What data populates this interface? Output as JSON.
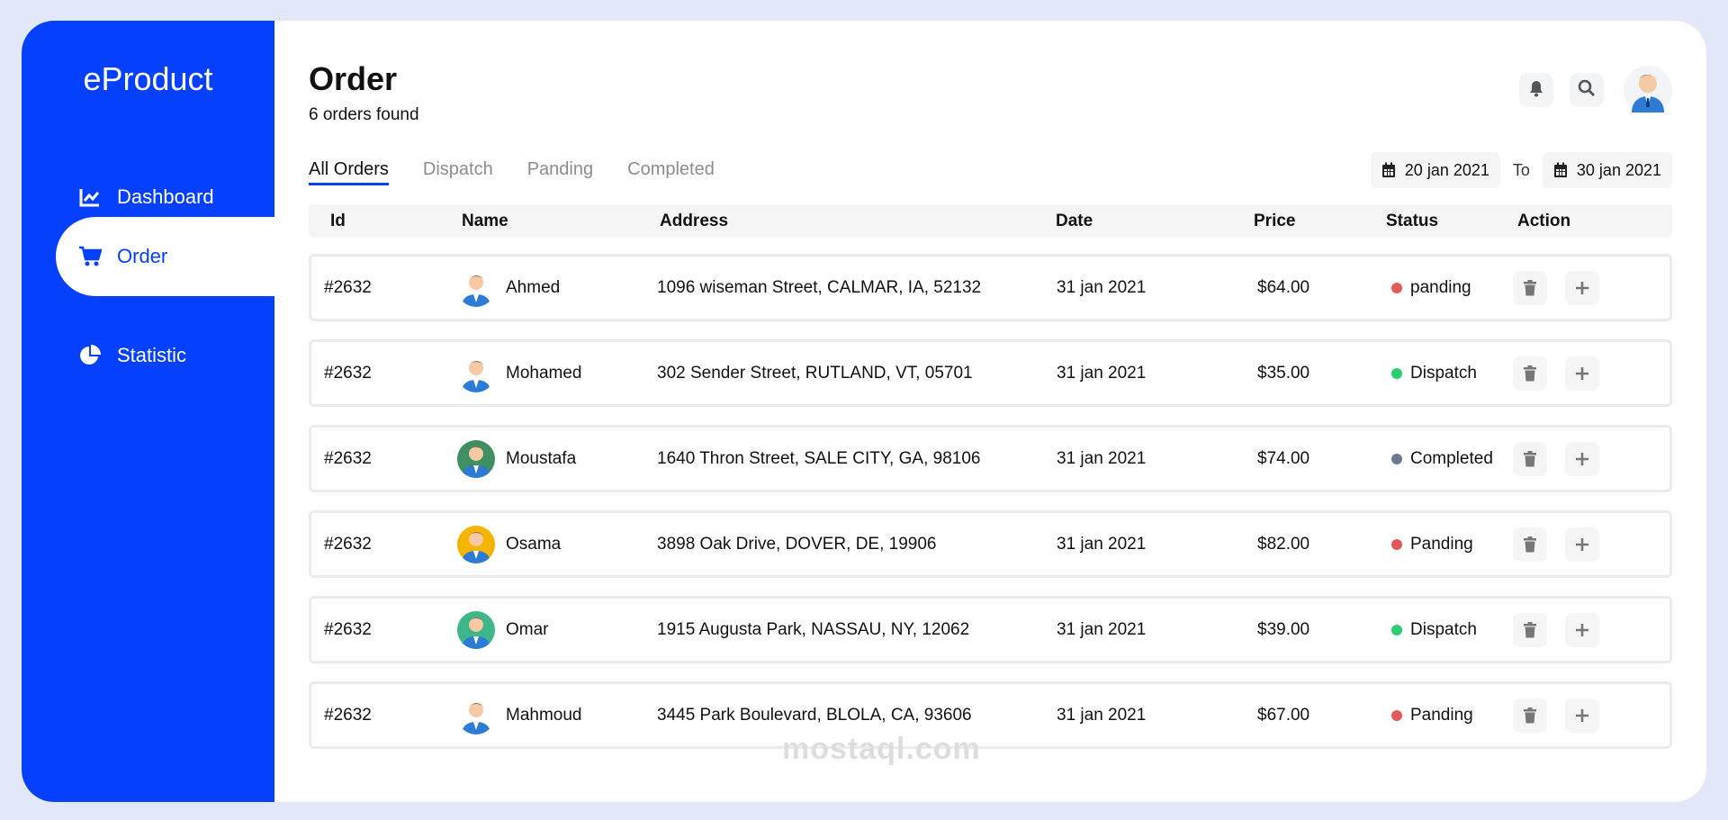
{
  "app": {
    "name": "eProduct"
  },
  "sidebar": {
    "items": [
      {
        "label": "Dashboard",
        "icon": "chart-line-icon",
        "active": false
      },
      {
        "label": "Order",
        "icon": "shopping-cart-icon",
        "active": true
      },
      {
        "label": "Statistic",
        "icon": "pie-chart-icon",
        "active": false
      }
    ]
  },
  "header": {
    "title": "Order",
    "subtitle": "6 orders found"
  },
  "tabs": [
    {
      "label": "All Orders",
      "active": true
    },
    {
      "label": "Dispatch",
      "active": false
    },
    {
      "label": "Panding",
      "active": false
    },
    {
      "label": "Completed",
      "active": false
    }
  ],
  "date_range": {
    "from": "20 jan 2021",
    "to_label": "To",
    "to": "30 jan 2021"
  },
  "table": {
    "columns": [
      "Id",
      "Name",
      "Address",
      "Date",
      "Price",
      "Status",
      "Action"
    ],
    "rows": [
      {
        "id": "#2632",
        "name": "Ahmed",
        "address": "1096 wiseman Street, CALMAR, IA, 52132",
        "date": "31 jan 2021",
        "price": "$64.00",
        "status": "panding",
        "status_color": "#e05a5a",
        "avatar_color": "#ffffff"
      },
      {
        "id": "#2632",
        "name": "Mohamed",
        "address": "302 Sender Street, RUTLAND, VT, 05701",
        "date": "31 jan 2021",
        "price": "$35.00",
        "status": "Dispatch",
        "status_color": "#2ecc71",
        "avatar_color": "#ffffff"
      },
      {
        "id": "#2632",
        "name": "Moustafa",
        "address": "1640 Thron Street, SALE CITY, GA, 98106",
        "date": "31 jan 2021",
        "price": "$74.00",
        "status": "Completed",
        "status_color": "#6b7a8f",
        "avatar_color": "#3f8f63"
      },
      {
        "id": "#2632",
        "name": "Osama",
        "address": "3898 Oak Drive, DOVER, DE, 19906",
        "date": "31 jan 2021",
        "price": "$82.00",
        "status": "Panding",
        "status_color": "#e05a5a",
        "avatar_color": "#f5b400"
      },
      {
        "id": "#2632",
        "name": "Omar",
        "address": "1915 Augusta Park, NASSAU, NY, 12062",
        "date": "31 jan 2021",
        "price": "$39.00",
        "status": "Dispatch",
        "status_color": "#2ecc71",
        "avatar_color": "#3fb58a"
      },
      {
        "id": "#2632",
        "name": "Mahmoud",
        "address": "3445 Park Boulevard, BLOLA, CA, 93606",
        "date": "31 jan 2021",
        "price": "$67.00",
        "status": "Panding",
        "status_color": "#e05a5a",
        "avatar_color": "#ffffff"
      }
    ]
  },
  "icons": {
    "notification": "bell-icon",
    "search": "search-icon",
    "delete": "trash-icon",
    "add": "plus-icon",
    "calendar": "calendar-icon"
  },
  "watermark": "mostaql.com",
  "colors": {
    "brand": "#0540fc",
    "background": "#e2e8f7"
  }
}
